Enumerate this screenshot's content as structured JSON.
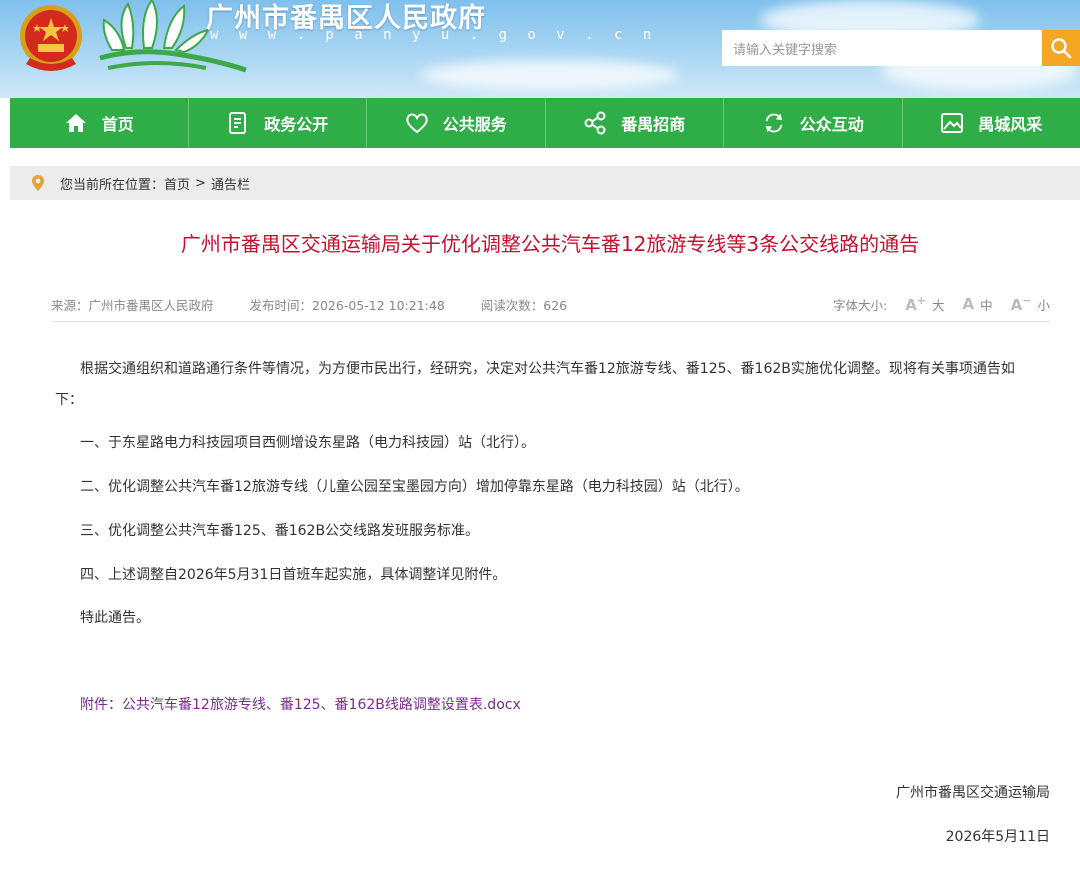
{
  "header": {
    "site_title": "广州市番禺区人民政府",
    "site_url": "w w w . p a n y u . g o v . c n",
    "search_placeholder": "请输入关键字搜索",
    "colors": {
      "banner": "#a9d6f3",
      "search_button": "#f5a623"
    }
  },
  "nav": {
    "color": "#2fae48",
    "items": [
      {
        "label": "首页",
        "icon": "home-icon"
      },
      {
        "label": "政务公开",
        "icon": "document-icon"
      },
      {
        "label": "公共服务",
        "icon": "heart-icon"
      },
      {
        "label": "番禺招商",
        "icon": "share-nodes-icon"
      },
      {
        "label": "公众互动",
        "icon": "refresh-icon"
      },
      {
        "label": "禺城风采",
        "icon": "picture-icon"
      }
    ]
  },
  "breadcrumb": {
    "prefix": "您当前所在位置：",
    "items": [
      "首页",
      "通告栏"
    ],
    "separator": ">"
  },
  "article": {
    "title": "广州市番禺区交通运输局关于优化调整公共汽车番12旅游专线等3条公交线路的通告",
    "source": "来源：广州市番禺区人民政府",
    "published": "发布时间：2026-05-12 10:21:48",
    "views": "阅读次数：626",
    "font_size_label": "字体大小:",
    "font_size_options": [
      {
        "glyph": "A",
        "mark": "+",
        "label": "大"
      },
      {
        "glyph": "A",
        "mark": "",
        "label": "中"
      },
      {
        "glyph": "A",
        "mark": "−",
        "label": "小"
      }
    ],
    "intro_line1": "根据交通组织和道路通行条件等情况，为方便市民出行，经研究，决定对公共汽车番12旅游专线、番125、番162B实施优化调整。现将有关事项通告如",
    "intro_line2": "下：",
    "items": [
      "一、于东星路电力科技园项目西侧增设东星路（电力科技园）站（北行）。",
      "二、优化调整公共汽车番12旅游专线（儿童公园至宝墨园方向）增加停靠东星路（电力科技园）站（北行）。",
      "三、优化调整公共汽车番125、番162B公交线路发班服务标准。",
      "四、上述调整自2026年5月31日首班车起实施，具体调整详见附件。",
      "特此通告。"
    ],
    "attachment": "附件：公共汽车番12旅游专线、番125、番162B线路调整设置表.docx",
    "signer": "广州市番禺区交通运输局",
    "sign_date": "2026年5月11日",
    "title_color": "#c8102e",
    "attachment_color": "#7b2b8f"
  }
}
